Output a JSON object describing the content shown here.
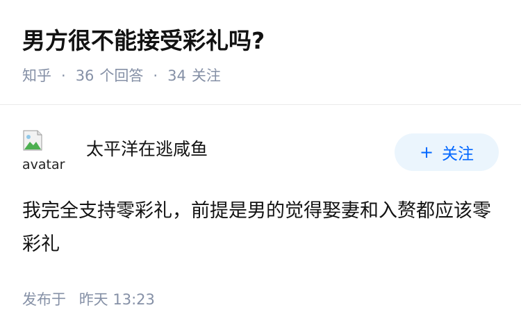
{
  "question": {
    "title": "男方很不能接受彩礼吗?",
    "source": "知乎",
    "answer_count": "36",
    "answer_unit": "个回答",
    "follower_count": "34",
    "follower_unit": "关注"
  },
  "answer": {
    "author": {
      "avatar_alt": "avatar",
      "name": "太平洋在逃咸鱼",
      "follow_label": "关注",
      "follow_icon": "plus-icon"
    },
    "content": "我完全支持零彩礼，前提是男的觉得娶妻和入赘都应该零彩礼",
    "publish_prefix": "发布于",
    "publish_day": "昨天",
    "publish_time": "13:23"
  },
  "colors": {
    "text_primary": "#121212",
    "text_secondary": "#8590a6",
    "accent": "#0066ff",
    "follow_bg": "#ebf5fd",
    "divider": "#ebebeb"
  }
}
